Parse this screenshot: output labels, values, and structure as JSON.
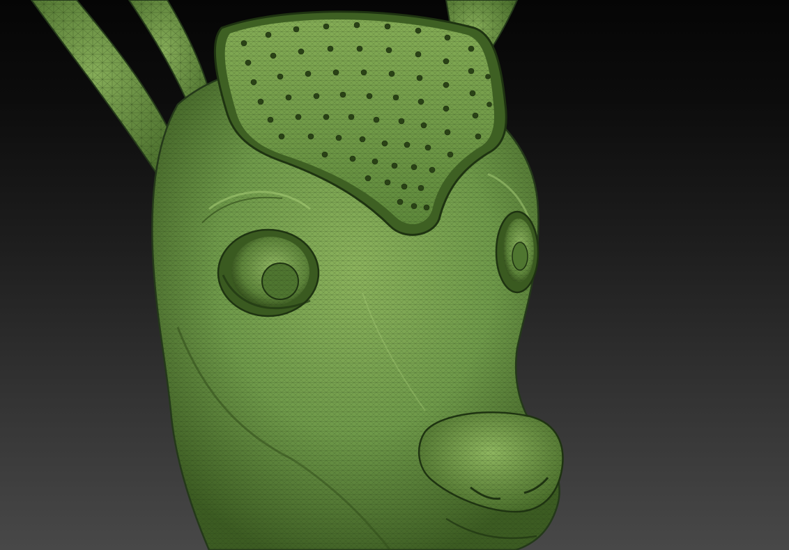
{
  "viewport": {
    "subject": "deer-head-sculpt",
    "display_mode": "polyframe-wireframe",
    "colors": {
      "mesh_base": "#6f9a4a",
      "mesh_light": "#9cc26c",
      "mesh_shadow": "#2c4616",
      "wire": "#1e3311",
      "background_top": "#050505",
      "background_bottom": "#484848"
    }
  }
}
